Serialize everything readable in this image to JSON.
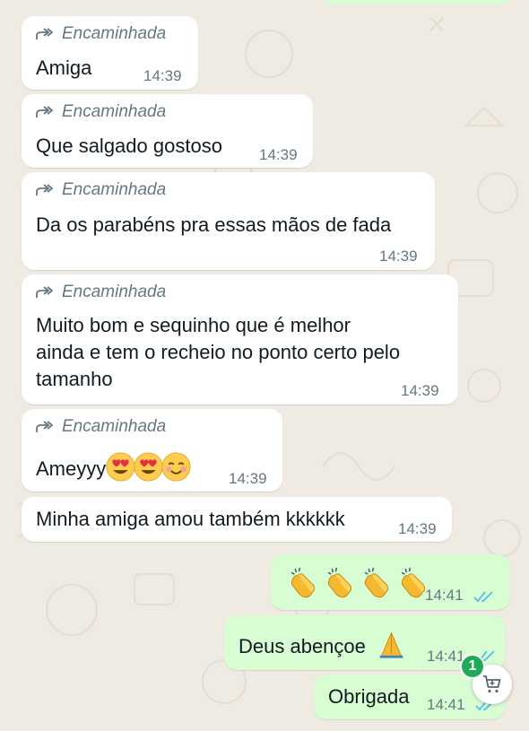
{
  "chat": {
    "forwarded_label": "Encaminhada",
    "incoming": [
      {
        "text": "Amiga",
        "time": "14:39",
        "forwarded": true
      },
      {
        "text": "Que salgado gostoso",
        "time": "14:39",
        "forwarded": true
      },
      {
        "text": "Da os parabéns pra essas mãos de fada",
        "time": "14:39",
        "forwarded": true
      },
      {
        "lines": [
          "Muito bom e sequinho que é melhor",
          "ainda e tem o recheio no ponto certo pelo",
          "tamanho"
        ],
        "time": "14:39",
        "forwarded": true
      },
      {
        "text": "Ameyyy",
        "emojis": [
          "heart-eyes-emoji",
          "heart-eyes-emoji",
          "smiling-blush-emoji"
        ],
        "time": "14:39",
        "forwarded": true
      },
      {
        "text": "Minha amiga amou também kkkkkk",
        "time": "14:39",
        "forwarded": false
      }
    ],
    "outgoing": [
      {
        "emojis": [
          "clapping-hands-emoji",
          "clapping-hands-emoji",
          "clapping-hands-emoji",
          "clapping-hands-emoji"
        ],
        "time": "14:41",
        "status": "read"
      },
      {
        "text": "Deus abençoe",
        "emoji": "folded-hands-emoji",
        "time": "14:41",
        "status": "read"
      },
      {
        "text": "Obrigada",
        "time": "14:41",
        "status": "read"
      }
    ]
  },
  "cart": {
    "badge": "1",
    "icon": "shopping-cart-icon"
  },
  "colors": {
    "background": "#efeae2",
    "incoming_bubble": "#ffffff",
    "outgoing_bubble": "#d9fdd3",
    "read_ticks": "#53bdeb",
    "badge": "#1faa59"
  }
}
